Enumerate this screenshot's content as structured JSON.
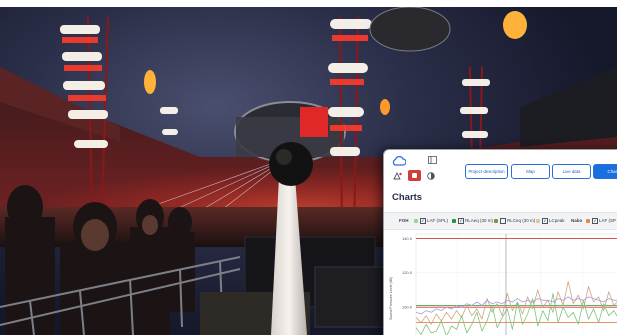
{
  "photo": {
    "description_free": true
  },
  "app": {
    "icons": [
      "cloud-icon",
      "sidebar-toggle-icon",
      "notification-icon",
      "record-icon",
      "contrast-icon"
    ],
    "nav_buttons": [
      "Project description",
      "Map",
      "Live data",
      "Charts"
    ],
    "active_nav": "Charts",
    "accent_color": "#1a6fe0",
    "page_title": "Charts",
    "legend": {
      "groups": [
        {
          "label": "FOH",
          "items": [
            "LAF (SPL)",
            "RLAeq (30 m)",
            "RLCeq (30 m)",
            "LCpeak"
          ]
        },
        {
          "label": "Nabo",
          "items": [
            "LAF (SP"
          ]
        }
      ]
    }
  },
  "chart_data": {
    "type": "line",
    "title": "",
    "xlabel": "",
    "ylabel": "Sound Pressure Level (dB)",
    "ylim": [
      75,
      145
    ],
    "yticks": [
      "140.0",
      "120.0",
      "100.0",
      "80.0"
    ],
    "grid": true,
    "reference_lines": [
      {
        "value": 140,
        "color": "#d43a3a"
      },
      {
        "value": 101,
        "color": "#4aa64a"
      },
      {
        "value": 100,
        "color": "#d43a3a"
      },
      {
        "value": 91,
        "color": "#e8834a"
      },
      {
        "value": 83,
        "color": "#2f8f3f"
      }
    ],
    "series": [
      {
        "color": "#cfa57e",
        "values": [
          94,
          91,
          95,
          90,
          96,
          92,
          97,
          93,
          98,
          94,
          101,
          95,
          99,
          93,
          105,
          97,
          102,
          95,
          108,
          98,
          103,
          96,
          106,
          99,
          110,
          100,
          104,
          97,
          109,
          101,
          115,
          102,
          107,
          99,
          112,
          103,
          106,
          98,
          109,
          101,
          104,
          100
        ]
      },
      {
        "color": "#7cc47c",
        "values": [
          88,
          84,
          90,
          85,
          86,
          92,
          83,
          89,
          87,
          95,
          85,
          90,
          97,
          86,
          92,
          101,
          88,
          94,
          99,
          87,
          103,
          90,
          96,
          105,
          89,
          98,
          92,
          108,
          91,
          100,
          94,
          97,
          90,
          104,
          93,
          99,
          91,
          102,
          95,
          98,
          93,
          96
        ]
      },
      {
        "color": "#a89bd9",
        "values": [
          97,
          96,
          98,
          97,
          99,
          98,
          100,
          99,
          101,
          100,
          102,
          101,
          103,
          101,
          104,
          102,
          103,
          102,
          104,
          103,
          105,
          103,
          104,
          103,
          105,
          104,
          104,
          103,
          105,
          104,
          106,
          104,
          105,
          104,
          106,
          105,
          104,
          103,
          105,
          104,
          104,
          103
        ]
      }
    ]
  }
}
